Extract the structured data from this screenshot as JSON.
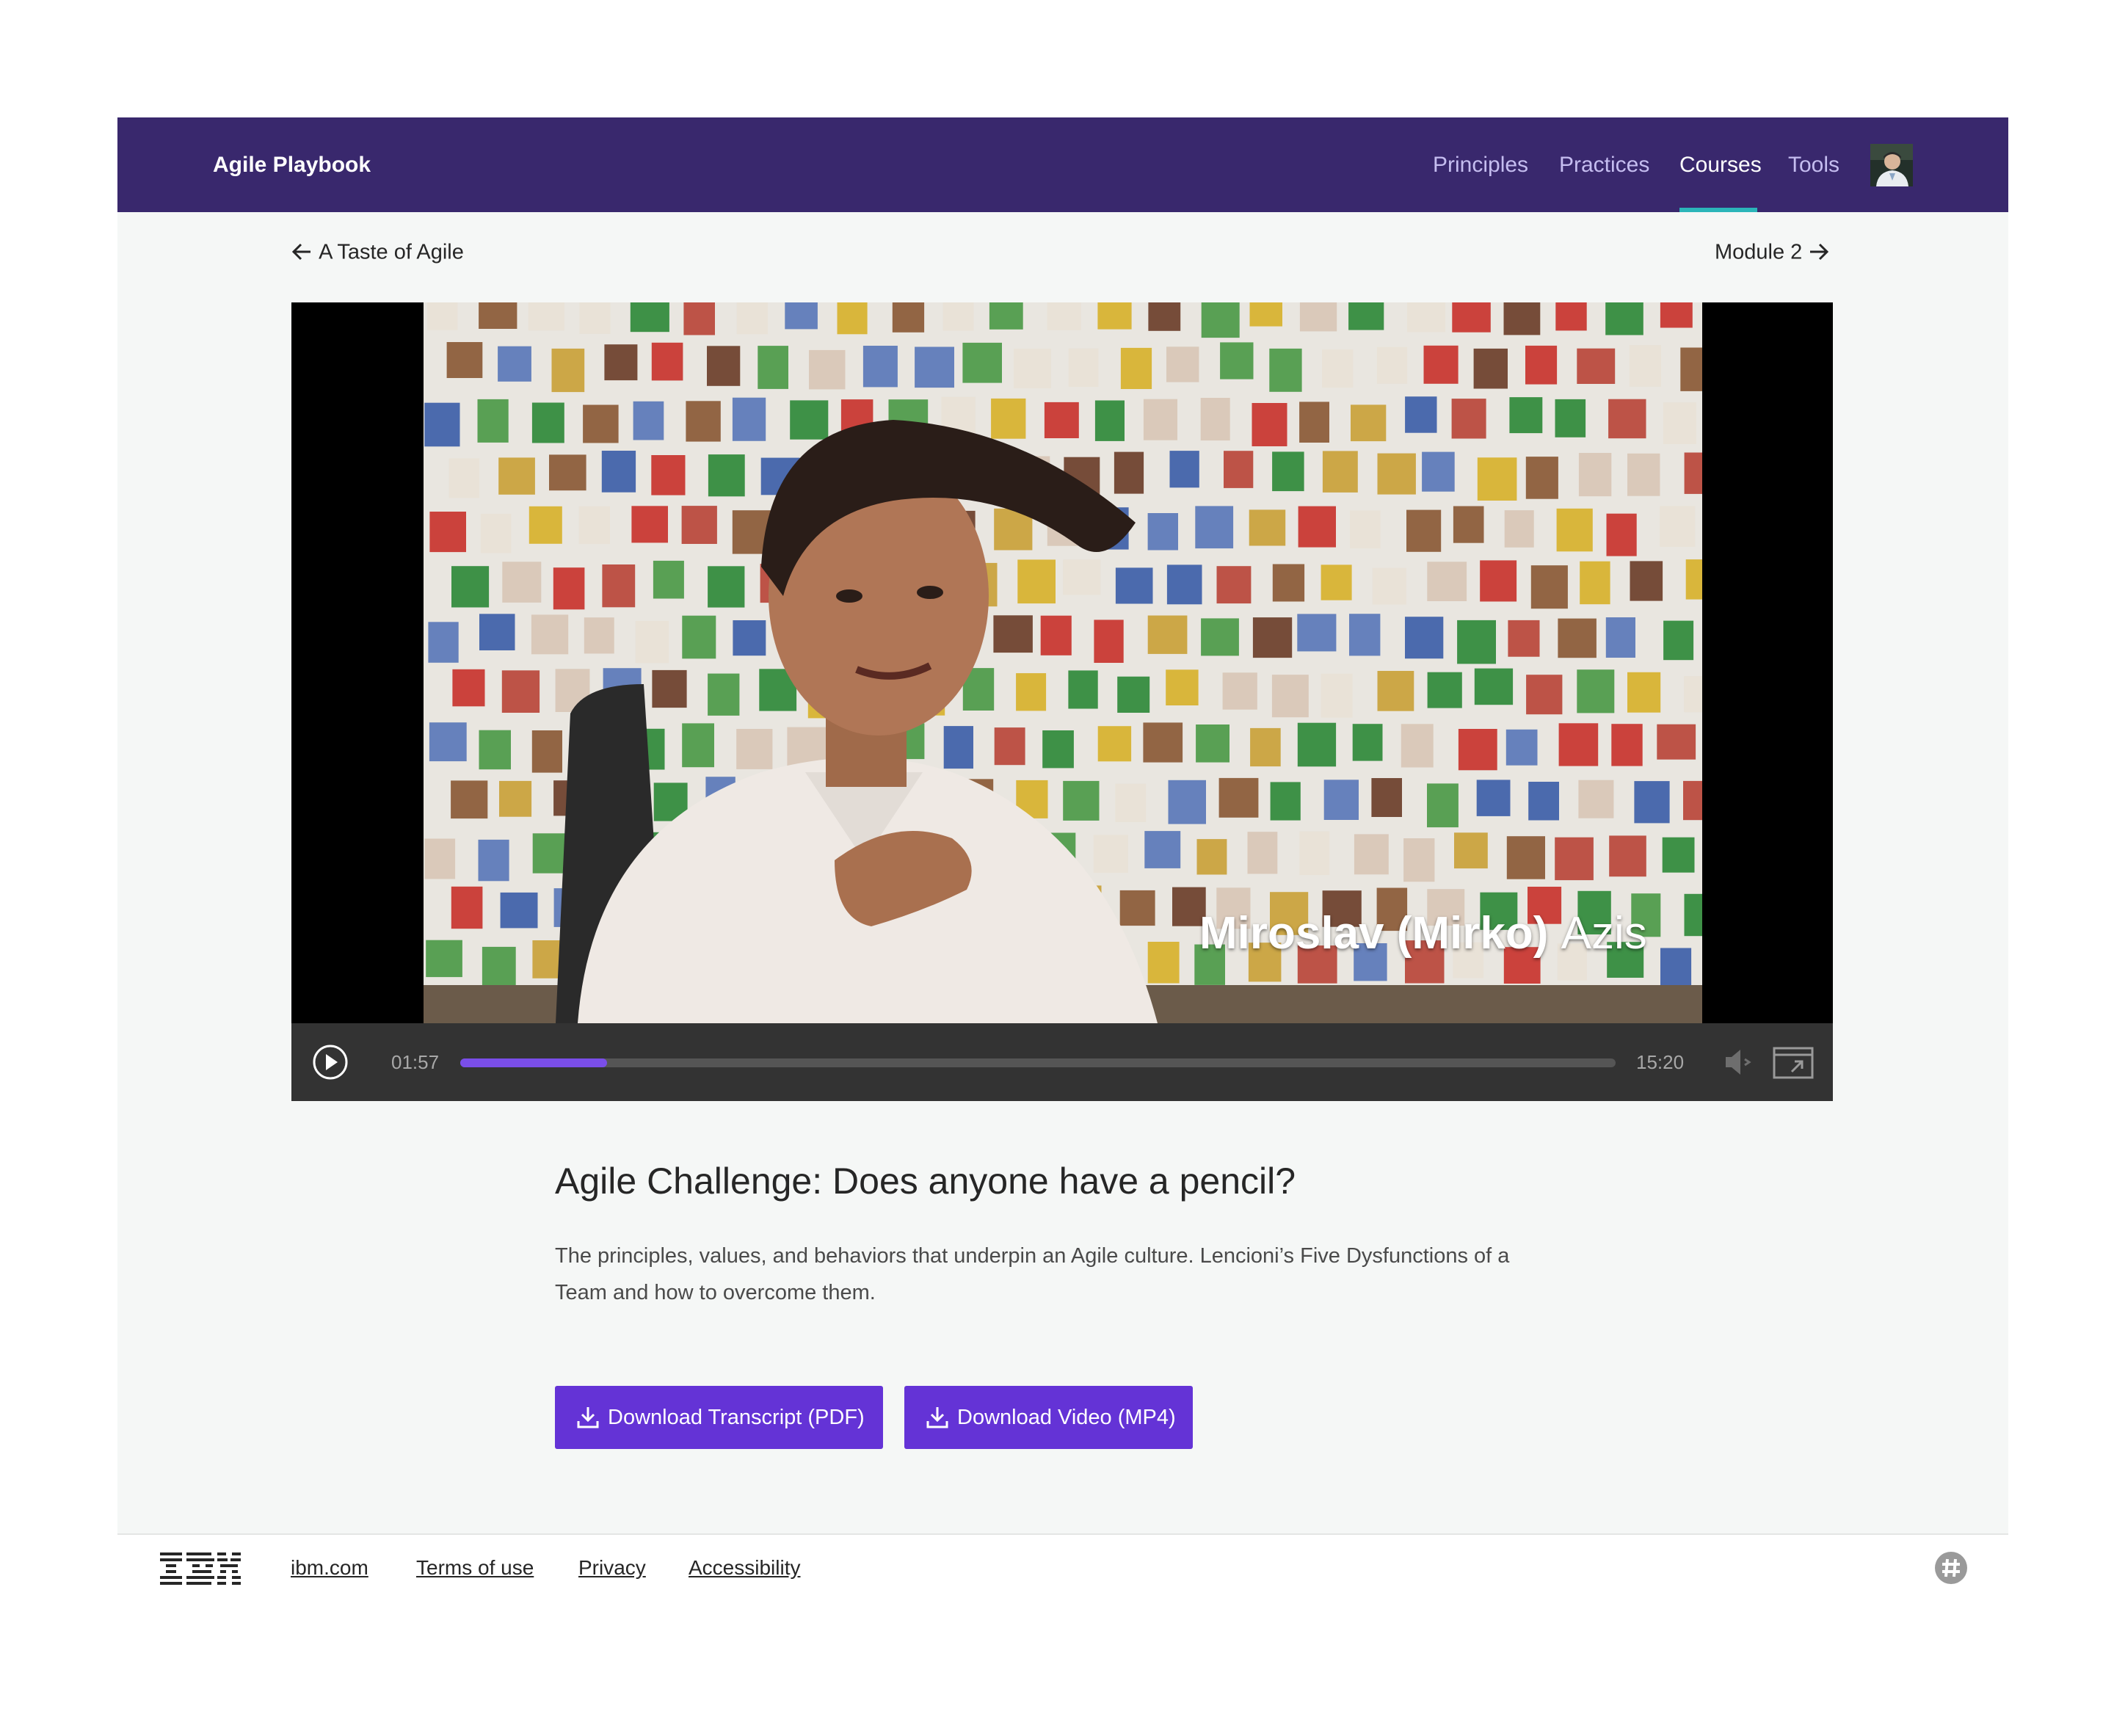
{
  "header": {
    "brand": "Agile Playbook",
    "nav": [
      {
        "label": "Principles",
        "active": false
      },
      {
        "label": "Practices",
        "active": false
      },
      {
        "label": "Courses",
        "active": true
      },
      {
        "label": "Tools",
        "active": false
      }
    ],
    "avatar_icon": "user-avatar"
  },
  "pager": {
    "prev_label": "A Taste of Agile",
    "next_label": "Module 2",
    "prev_icon": "arrow-left-icon",
    "next_icon": "arrow-right-icon"
  },
  "video": {
    "caption_name": "Miroslav (Mirko)",
    "caption_surname": "Azis",
    "current_time": "01:57",
    "duration": "15:20",
    "progress_fraction": 0.127,
    "icons": [
      "play-icon",
      "volume-muted-icon",
      "fullscreen-icon"
    ]
  },
  "content": {
    "title": "Agile Challenge: Does anyone have a pencil?",
    "description": "The principles, values, and behaviors that underpin an Agile culture. Lencioni’s Five Dysfunctions of a Team and how to overcome them.",
    "buttons": [
      {
        "label": "Download Transcript (PDF)",
        "icon": "download-icon"
      },
      {
        "label": "Download Video (MP4)",
        "icon": "download-icon"
      }
    ]
  },
  "footer": {
    "logo": "IBM",
    "links": [
      "ibm.com",
      "Terms of use",
      "Privacy",
      "Accessibility"
    ],
    "slack_icon": "slack-icon"
  },
  "colors": {
    "header_bg": "#39286d",
    "accent": "#6433d6",
    "nav_underline": "#2bb5b9",
    "progress": "#7a4ee8"
  }
}
